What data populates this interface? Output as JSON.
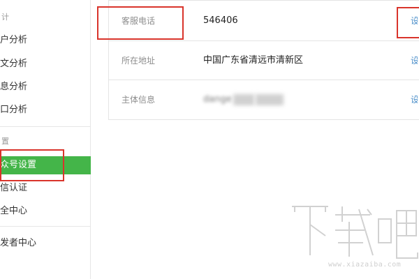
{
  "sidebar": {
    "section1_title": "计",
    "section1_items": [
      {
        "label": "户分析"
      },
      {
        "label": "文分析"
      },
      {
        "label": "息分析"
      },
      {
        "label": "口分析"
      }
    ],
    "section2_title": "置",
    "section2_items": [
      {
        "label": "众号设置",
        "active": true
      },
      {
        "label": "信认证"
      },
      {
        "label": "全中心"
      }
    ],
    "section3_items": [
      {
        "label": "发者中心"
      }
    ]
  },
  "info": {
    "rows": [
      {
        "label": "客服电话",
        "value": "546406",
        "action": "设"
      },
      {
        "label": "所在地址",
        "value": "中国广东省清远市清新区",
        "action": "设"
      },
      {
        "label": "主体信息",
        "value": "dange",
        "action": "设"
      }
    ]
  },
  "watermark": {
    "text": "下载吧",
    "url": "www.xiazaiba.com"
  },
  "colors": {
    "accent": "#44b549",
    "highlight_box": "#d9342b",
    "link": "#4a8ec9"
  }
}
